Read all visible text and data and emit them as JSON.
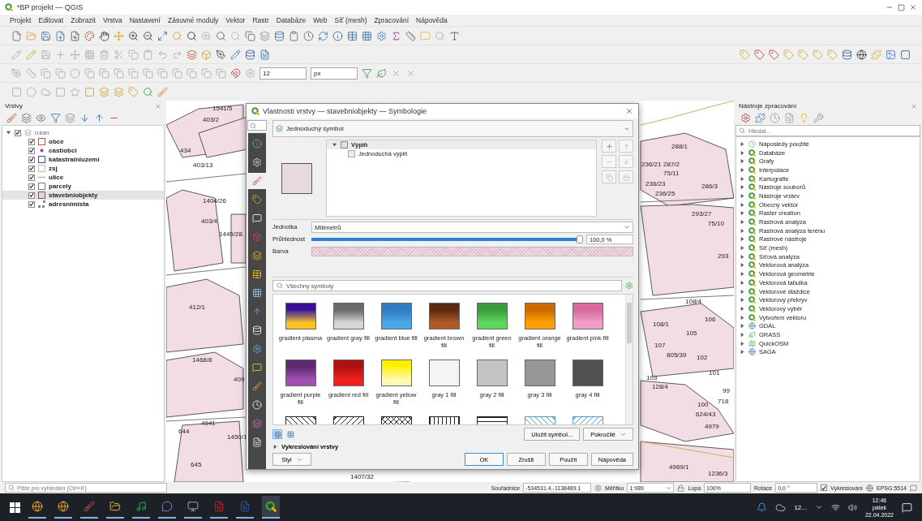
{
  "window": {
    "title": "*BP projekt — QGIS"
  },
  "menu": [
    "Projekt",
    "Editovat",
    "Zobrazit",
    "Vrstva",
    "Nastavení",
    "Zásuvné moduly",
    "Vektor",
    "Rastr",
    "Databáze",
    "Web",
    "Síť (mesh)",
    "Zpracování",
    "Nápověda"
  ],
  "snapping": {
    "tolerance": "12",
    "unit": "px"
  },
  "layers_panel": {
    "title": "Vrstvy",
    "tree": [
      {
        "name": "ruian",
        "checked": true,
        "expanded": true,
        "selected": false,
        "children": [
          {
            "name": "obce",
            "checked": true,
            "selected": false,
            "kind": "outline",
            "color": "#e53935"
          },
          {
            "name": "castiobci",
            "checked": true,
            "selected": false,
            "kind": "point",
            "color": "#8e44ad"
          },
          {
            "name": "katastralniuzemi",
            "checked": true,
            "selected": false,
            "kind": "outline",
            "color": "#3344cc"
          },
          {
            "name": "zsj",
            "checked": true,
            "selected": false,
            "kind": "outline",
            "color": "#f4a6b0"
          },
          {
            "name": "ulice",
            "checked": true,
            "selected": false,
            "kind": "line",
            "color": "#c8b48a"
          },
          {
            "name": "parcely",
            "checked": true,
            "selected": false,
            "kind": "outline",
            "color": "#777777"
          },
          {
            "name": "stavebniobjekty",
            "checked": true,
            "selected": true,
            "kind": "fill",
            "color": "#e3d3dc"
          },
          {
            "name": "adresnimista",
            "checked": true,
            "selected": false,
            "kind": "points",
            "color": "#888888"
          }
        ]
      }
    ]
  },
  "map": {
    "labels": [
      "1541/5",
      "403/2",
      "434",
      "403/13",
      "1404/26",
      "403/4",
      "1445/28",
      "412/1",
      "1468/8",
      "409",
      "644",
      "645",
      "4941",
      "1450/1",
      "1407/32",
      "288/1",
      "236/21",
      "287/2",
      "75/11",
      "236/23",
      "286/3",
      "236/25",
      "293/27",
      "75/10",
      "293",
      "108/4",
      "106",
      "108/1",
      "105",
      "107",
      "805/39",
      "102",
      "101",
      "103",
      "128/4",
      "99",
      "100",
      "718",
      "624/43",
      "4979",
      "4969/1",
      "1236/3"
    ]
  },
  "dialog": {
    "title": "Vlastnosti vrstvy — stavebniobjekty — Symbologie",
    "renderer": "Jednoduchý symbol",
    "sidebar_tabs": [
      {
        "selected": false
      },
      {
        "selected": false
      },
      {
        "selected": true
      },
      {
        "selected": false
      },
      {
        "selected": false
      },
      {
        "selected": false
      },
      {
        "selected": false
      },
      {
        "selected": false
      },
      {
        "selected": false
      },
      {
        "selected": false
      },
      {
        "selected": false
      },
      {
        "selected": false
      },
      {
        "selected": false
      },
      {
        "selected": false
      },
      {
        "selected": false
      },
      {
        "selected": false
      },
      {
        "selected": false
      }
    ],
    "symbol_tree": {
      "name": "Výplň",
      "expanded": true,
      "selected": true,
      "children": [
        {
          "name": "Jednoduchá výplň",
          "selected": false
        }
      ]
    },
    "unit": {
      "label": "Jednotka",
      "value": "Milimetrů"
    },
    "opacity": {
      "label": "Průhlednost",
      "level": 1.0,
      "reading": "100,0 %"
    },
    "color_label": "Barva",
    "library": {
      "search_placeholder": "Všechny symboly",
      "view_modes": [
        {
          "selected": true
        },
        {
          "selected": false
        }
      ],
      "symbols": [
        {
          "name": "gradient plasma",
          "kind": "gradient",
          "stops": [
            {
              "color": "#3c0f9a"
            },
            {
              "color": "#f7c320"
            }
          ]
        },
        {
          "name": "gradient  gray fill",
          "kind": "gradient",
          "stops": [
            {
              "color": "#6a6a6a"
            },
            {
              "color": "#d6d6d6"
            }
          ]
        },
        {
          "name": "gradient blue fill",
          "kind": "gradient",
          "stops": [
            {
              "color": "#2f7dc0"
            },
            {
              "color": "#4aa6e6"
            }
          ]
        },
        {
          "name": "gradient brown fill",
          "kind": "gradient",
          "stops": [
            {
              "color": "#5b2b10"
            },
            {
              "color": "#b05a2a"
            }
          ]
        },
        {
          "name": "gradient green fill",
          "kind": "gradient",
          "stops": [
            {
              "color": "#3c9a3c"
            },
            {
              "color": "#5fd85f"
            }
          ]
        },
        {
          "name": "gradient orange fill",
          "kind": "gradient",
          "stops": [
            {
              "color": "#cc6a00"
            },
            {
              "color": "#ffa000"
            }
          ]
        },
        {
          "name": "gradient pink fill",
          "kind": "gradient",
          "stops": [
            {
              "color": "#d86aa0"
            },
            {
              "color": "#f0a0c8"
            }
          ]
        },
        {
          "name": "gradient purple fill",
          "kind": "gradient",
          "stops": [
            {
              "color": "#5c2a70"
            },
            {
              "color": "#a050b0"
            }
          ]
        },
        {
          "name": "gradient red fill",
          "kind": "gradient",
          "stops": [
            {
              "color": "#b01010"
            },
            {
              "color": "#f02020"
            }
          ]
        },
        {
          "name": "gradient yellow fill",
          "kind": "gradient",
          "stops": [
            {
              "color": "#fff000"
            },
            {
              "color": "#fffab0"
            }
          ]
        },
        {
          "name": "gray 1 fill",
          "kind": "solid",
          "color": "#f4f4f4"
        },
        {
          "name": "gray 2 fill",
          "kind": "solid",
          "color": "#c4c4c4"
        },
        {
          "name": "gray 3 fill",
          "kind": "solid",
          "color": "#969696"
        },
        {
          "name": "gray 4 fill",
          "kind": "solid",
          "color": "#505050"
        },
        {
          "kind": "diagonal",
          "color": "#222222"
        },
        {
          "kind": "backdiagonal",
          "color": "#222222"
        },
        {
          "kind": "cross",
          "color": "#222222"
        },
        {
          "kind": "vertical",
          "color": "#222222"
        },
        {
          "kind": "horizontal",
          "color": "#222222"
        },
        {
          "kind": "diagonal",
          "color": "#5a9ad0"
        },
        {
          "kind": "backdiagonal",
          "color": "#5a9ad0"
        }
      ]
    },
    "save_symbol": "Uložit symbol...",
    "advanced": "Pokročilé",
    "layer_rendering": {
      "label": "Vykreslování vrstvy",
      "expanded": false
    },
    "style": "Styl",
    "buttons": [
      "OK",
      "Zrušit",
      "Použít",
      "Nápověda"
    ]
  },
  "processing": {
    "title": "Nástroje zpracování",
    "search_placeholder": "Hledat...",
    "groups": [
      {
        "name": "Naposledy použité",
        "kind": "recent",
        "expanded": false
      },
      {
        "name": "Databáze",
        "kind": "qgis",
        "expanded": false
      },
      {
        "name": "Grafy",
        "kind": "qgis",
        "expanded": false
      },
      {
        "name": "Interpolace",
        "kind": "qgis",
        "expanded": false
      },
      {
        "name": "Kartografie",
        "kind": "qgis",
        "expanded": false
      },
      {
        "name": "Nástroje souborů",
        "kind": "qgis",
        "expanded": false
      },
      {
        "name": "Nástroje vrstev",
        "kind": "qgis",
        "expanded": false
      },
      {
        "name": "Obecný vektor",
        "kind": "qgis",
        "expanded": false
      },
      {
        "name": "Raster creation",
        "kind": "qgis",
        "expanded": false
      },
      {
        "name": "Rastrová analýza",
        "kind": "qgis",
        "expanded": false
      },
      {
        "name": "Rastrová analýza terénu",
        "kind": "qgis",
        "expanded": false
      },
      {
        "name": "Rastrové nástroje",
        "kind": "qgis",
        "expanded": false
      },
      {
        "name": "Síť (mesh)",
        "kind": "qgis",
        "expanded": false
      },
      {
        "name": "Síťová analýza",
        "kind": "qgis",
        "expanded": false
      },
      {
        "name": "Vektorová analýza",
        "kind": "qgis",
        "expanded": false
      },
      {
        "name": "Vektorová geometrie",
        "kind": "qgis",
        "expanded": false
      },
      {
        "name": "Vektorová tabulka",
        "kind": "qgis",
        "expanded": false
      },
      {
        "name": "Vektorové dlaždice",
        "kind": "qgis",
        "expanded": false
      },
      {
        "name": "Vektorový překryv",
        "kind": "qgis",
        "expanded": false
      },
      {
        "name": "Vektorový výběr",
        "kind": "qgis",
        "expanded": false
      },
      {
        "name": "Vytvoření vektoru",
        "kind": "qgis",
        "expanded": false
      },
      {
        "name": "GDAL",
        "kind": "gdal",
        "expanded": false
      },
      {
        "name": "GRASS",
        "kind": "grass",
        "expanded": false
      },
      {
        "name": "QuickOSM",
        "kind": "osm",
        "expanded": false
      },
      {
        "name": "SAGA",
        "kind": "saga",
        "expanded": false
      }
    ]
  },
  "status_bar": {
    "search_placeholder": "Pište pro vyhledání (Ctrl+K)",
    "coordinate_label": "Souřadnice",
    "coordinate": "-534531.4,-1138489.1",
    "scale_label": "Měřítko",
    "scale": "1:989",
    "magnifier_label": "Lupa",
    "magnifier": "100%",
    "rotation_label": "Rotace",
    "rotation": "0,0 °",
    "render": {
      "label": "Vykreslování",
      "checked": true
    },
    "crs": "EPSG:5514"
  },
  "taskbar": {
    "apps": [
      {
        "kind": "browser"
      },
      {
        "kind": "browser"
      },
      {
        "kind": "paint"
      },
      {
        "kind": "files"
      },
      {
        "kind": "music"
      },
      {
        "kind": "chat"
      },
      {
        "kind": "remote"
      },
      {
        "kind": "pdf"
      },
      {
        "kind": "word"
      },
      {
        "kind": "qgis"
      }
    ],
    "weather": "12...",
    "time": "12:46",
    "day": "pátek",
    "date": "22.04.2022"
  }
}
